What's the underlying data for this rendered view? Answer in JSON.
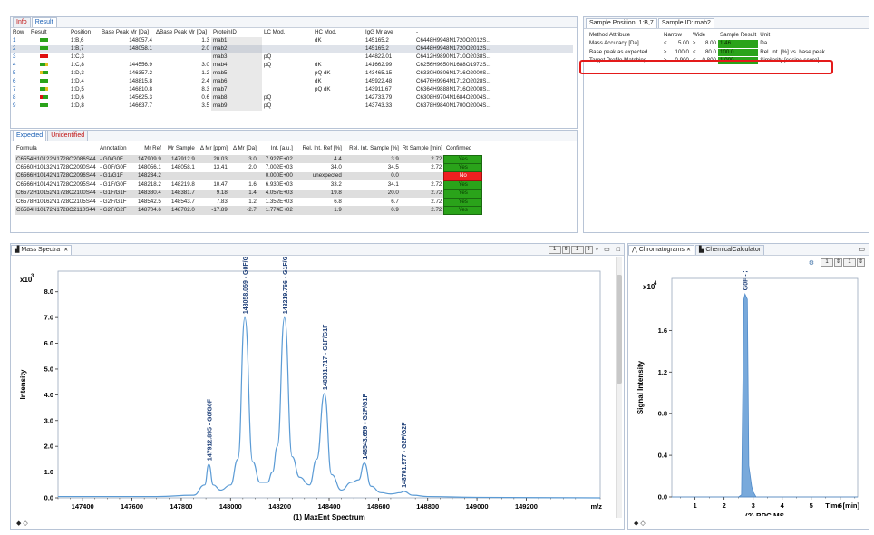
{
  "top_tabs": [
    "Info",
    "Result"
  ],
  "result_table": {
    "headers": [
      "Row",
      "Result",
      "Position",
      "Base Peak Mr [Da]",
      "ΔBase Peak Mr [Da]",
      "ProteinID",
      "LC Mod.",
      "HC Mod.",
      "IgG Mr ave",
      "-"
    ],
    "rows": [
      {
        "row": "1",
        "pos": "1:B,6",
        "bp": "148057.4",
        "dbp": "1.3",
        "pid": "mab1",
        "lc": "",
        "hc": "dK",
        "igg": "145165.2",
        "f": "C6448H9948N1720O2012S..."
      },
      {
        "row": "2",
        "pos": "1:B,7",
        "bp": "148058.1",
        "dbp": "2.0",
        "pid": "mab2",
        "lc": "",
        "hc": "",
        "igg": "145165.2",
        "f": "C6448H9948N1720O2012S..."
      },
      {
        "row": "3",
        "pos": "1:C,3",
        "bp": "",
        "dbp": "",
        "pid": "mab3",
        "lc": "pQ",
        "hc": "",
        "igg": "144822.01",
        "f": "C6412H9890N1710O2038S..."
      },
      {
        "row": "4",
        "pos": "1:C,8",
        "bp": "144556.9",
        "dbp": "3.0",
        "pid": "mab4",
        "lc": "pQ",
        "hc": "dK",
        "igg": "141662.99",
        "f": "C6256H9650N1688O1972S..."
      },
      {
        "row": "5",
        "pos": "1:D,3",
        "bp": "146357.2",
        "dbp": "1.2",
        "pid": "mab5",
        "lc": "",
        "hc": "pQ dK",
        "igg": "143465.15",
        "f": "C6330H9806N1716O2000S..."
      },
      {
        "row": "6",
        "pos": "1:D,4",
        "bp": "148815.8",
        "dbp": "2.4",
        "pid": "mab6",
        "lc": "",
        "hc": "dK",
        "igg": "145922.48",
        "f": "C6476H9964N1712O2028S..."
      },
      {
        "row": "7",
        "pos": "1:D,5",
        "bp": "146810.8",
        "dbp": "8.3",
        "pid": "mab7",
        "lc": "",
        "hc": "pQ dK",
        "igg": "143911.67",
        "f": "C6364H9888N1716O2008S..."
      },
      {
        "row": "8",
        "pos": "1:D,6",
        "bp": "145625.3",
        "dbp": "0.6",
        "pid": "mab8",
        "lc": "pQ",
        "hc": "",
        "igg": "142733.79",
        "f": "C6308H9704N1684O2004S..."
      },
      {
        "row": "9",
        "pos": "1:D,8",
        "bp": "146637.7",
        "dbp": "3.5",
        "pid": "mab9",
        "lc": "pQ",
        "hc": "",
        "igg": "143743.33",
        "f": "C6378H9840N1700O2004S..."
      }
    ]
  },
  "lower_tabs": [
    "Expected",
    "Unidentified"
  ],
  "expected_table": {
    "headers": [
      "Formula",
      "Annotation",
      "Mr Ref",
      "Mr Sample",
      "Δ Mr [ppm]",
      "Δ Mr [Da]",
      "Int. [a.u.]",
      "Rel. Int. Ref [%]",
      "Rel. Int. Sample [%]",
      "Rt Sample [min]",
      "Confirmed"
    ],
    "rows": [
      {
        "f": "C6554H10122N1728O2086S44",
        "a": "- G0/G0F",
        "ref": "147909.9",
        "s": "147912.9",
        "ppm": "20.03",
        "da": "3.0",
        "i": "7.927E+02",
        "rr": "4.4",
        "rs": "3.9",
        "rt": "2.72",
        "c": "Yes"
      },
      {
        "f": "C6560H10132N1728O2090S44",
        "a": "- G0F/G0F",
        "ref": "148056.1",
        "s": "148058.1",
        "ppm": "13.41",
        "da": "2.0",
        "i": "7.002E+03",
        "rr": "34.0",
        "rs": "34.5",
        "rt": "2.72",
        "c": "Yes"
      },
      {
        "f": "C6566H10142N1728O2096S44",
        "a": "- G1/G1F",
        "ref": "148234.2",
        "s": "",
        "ppm": "",
        "da": "",
        "i": "0.000E+00",
        "rr": "unexpected",
        "rs": "0.0",
        "rt": "",
        "c": "No"
      },
      {
        "f": "C6566H10142N1728O2095S44",
        "a": "- G1F/G0F",
        "ref": "148218.2",
        "s": "148219.8",
        "ppm": "10.47",
        "da": "1.6",
        "i": "6.930E+03",
        "rr": "33.2",
        "rs": "34.1",
        "rt": "2.72",
        "c": "Yes"
      },
      {
        "f": "C6572H10152N1728O2100S44",
        "a": "- G1F/G1F",
        "ref": "148380.4",
        "s": "148381.7",
        "ppm": "9.18",
        "da": "1.4",
        "i": "4.057E+03",
        "rr": "19.8",
        "rs": "20.0",
        "rt": "2.72",
        "c": "Yes"
      },
      {
        "f": "C6578H10162N1728O2105S44",
        "a": "- G2F/G1F",
        "ref": "148542.5",
        "s": "148543.7",
        "ppm": "7.83",
        "da": "1.2",
        "i": "1.352E+03",
        "rr": "6.8",
        "rs": "6.7",
        "rt": "2.72",
        "c": "Yes"
      },
      {
        "f": "C6584H10172N1728O2110S44",
        "a": "- G2F/G2F",
        "ref": "148704.6",
        "s": "148702.0",
        "ppm": "-17.89",
        "da": "-2.7",
        "i": "1.774E+02",
        "rr": "1.9",
        "rs": "0.9",
        "rt": "2.72",
        "c": "Yes"
      }
    ]
  },
  "sample_panel": {
    "position_label": "Sample Position: 1:B,7",
    "id_label": "Sample ID: mab2",
    "headers": [
      "Method Attribute",
      "Narrow",
      "Wide",
      "Sample Result",
      "Unit"
    ],
    "rows": [
      {
        "attr": "Mass Accuracy [Da]",
        "nop": "<",
        "n": "5.00",
        "wop": "≥",
        "w": "8.00",
        "res": "1.46",
        "unit": "Da"
      },
      {
        "attr": "Base peak as expected",
        "nop": "≥",
        "n": "100.0",
        "wop": "<",
        "w": "80.0",
        "res": "100.0",
        "unit": "Rel. int. [%] vs. base peak"
      },
      {
        "attr": "Target Profile Matching",
        "nop": "≥",
        "n": "0.900",
        "wop": "<",
        "w": "0.800",
        "res": "1.000",
        "unit": "Similarity [cosine score]"
      }
    ]
  },
  "mass_spectra": {
    "tab": "Mass Spectra",
    "spin1": "1",
    "spin2": "1",
    "scale_label": "x10",
    "scale_exp": "3",
    "ylabel": "Intensity",
    "xlabel": "(1) MaxEnt Spectrum",
    "xunit": "m/z"
  },
  "chromatograms": {
    "tab1": "Chromatograms",
    "tab2": "ChemicalCalculator",
    "spin1": "1",
    "spin2": "1",
    "scale_label": "x10",
    "scale_exp": "4",
    "ylabel": "Signal Intensity",
    "xlabel": "(2) BPC MS",
    "xunit": "Time [min]"
  },
  "chart_data": [
    {
      "type": "line",
      "title": "(1) MaxEnt Spectrum",
      "xlabel": "m/z",
      "ylabel": "Intensity",
      "xlim": [
        147300,
        149500
      ],
      "ylim": [
        0,
        8.8
      ],
      "y_scale": "x10^3",
      "xticks": [
        147400,
        147600,
        147800,
        148000,
        148200,
        148400,
        148600,
        148800,
        149000,
        149200
      ],
      "yticks": [
        0.0,
        1.0,
        2.0,
        3.0,
        4.0,
        5.0,
        6.0,
        7.0,
        8.0
      ],
      "series": [
        {
          "x": [
            147300,
            147700,
            147850,
            147895,
            147912,
            147930,
            147960,
            148000,
            148030,
            148058,
            148090,
            148120,
            148150,
            148170,
            148190,
            148219,
            148250,
            148280,
            148320,
            148350,
            148381,
            148410,
            148450,
            148490,
            148520,
            148543,
            148570,
            148610,
            148650,
            148690,
            148702,
            148740,
            148800,
            149000,
            149500
          ],
          "y": [
            0.05,
            0.05,
            0.1,
            0.5,
            1.3,
            0.5,
            0.3,
            0.5,
            1.5,
            7.0,
            1.4,
            0.6,
            0.6,
            1.0,
            2.0,
            7.0,
            1.6,
            0.8,
            0.5,
            1.5,
            4.05,
            0.9,
            0.3,
            0.6,
            0.7,
            1.35,
            0.45,
            0.2,
            0.15,
            0.2,
            0.25,
            0.1,
            0.05,
            0.02,
            0.0
          ]
        }
      ],
      "annotations": [
        {
          "x": 147912,
          "y": 1.3,
          "text": "147912.895 - G0/G0F"
        },
        {
          "x": 148058,
          "y": 7.0,
          "text": "148058.059 - G0F/G0F"
        },
        {
          "x": 148219,
          "y": 7.0,
          "text": "148219.766 - G1F/G0F"
        },
        {
          "x": 148381,
          "y": 4.05,
          "text": "148381.717 - G1F/G1F"
        },
        {
          "x": 148543,
          "y": 1.35,
          "text": "148543.659 - G2F/G1F"
        },
        {
          "x": 148702,
          "y": 0.25,
          "text": "148701.977 - G2F/G2F"
        }
      ]
    },
    {
      "type": "area",
      "title": "(2) BPC MS",
      "xlabel": "Time [min]",
      "ylabel": "Signal Intensity",
      "xlim": [
        0.2,
        6.6
      ],
      "ylim": [
        0,
        2.1
      ],
      "y_scale": "x10^4",
      "xticks": [
        1,
        2,
        3,
        4,
        5,
        6
      ],
      "yticks": [
        0.0,
        0.4,
        0.8,
        1.2,
        1.6
      ],
      "series": [
        {
          "x": [
            0.2,
            2.5,
            2.6,
            2.68,
            2.72,
            2.8,
            2.85,
            2.9,
            2.95,
            3.0,
            3.1,
            6.6
          ],
          "y": [
            0.0,
            0.0,
            0.02,
            1.9,
            1.95,
            1.9,
            0.3,
            0.2,
            0.1,
            0.05,
            0.0,
            0.0
          ]
        }
      ],
      "annotations": [
        {
          "x": 2.72,
          "y": 1.95,
          "text": "G0F - 2.72"
        }
      ]
    }
  ]
}
